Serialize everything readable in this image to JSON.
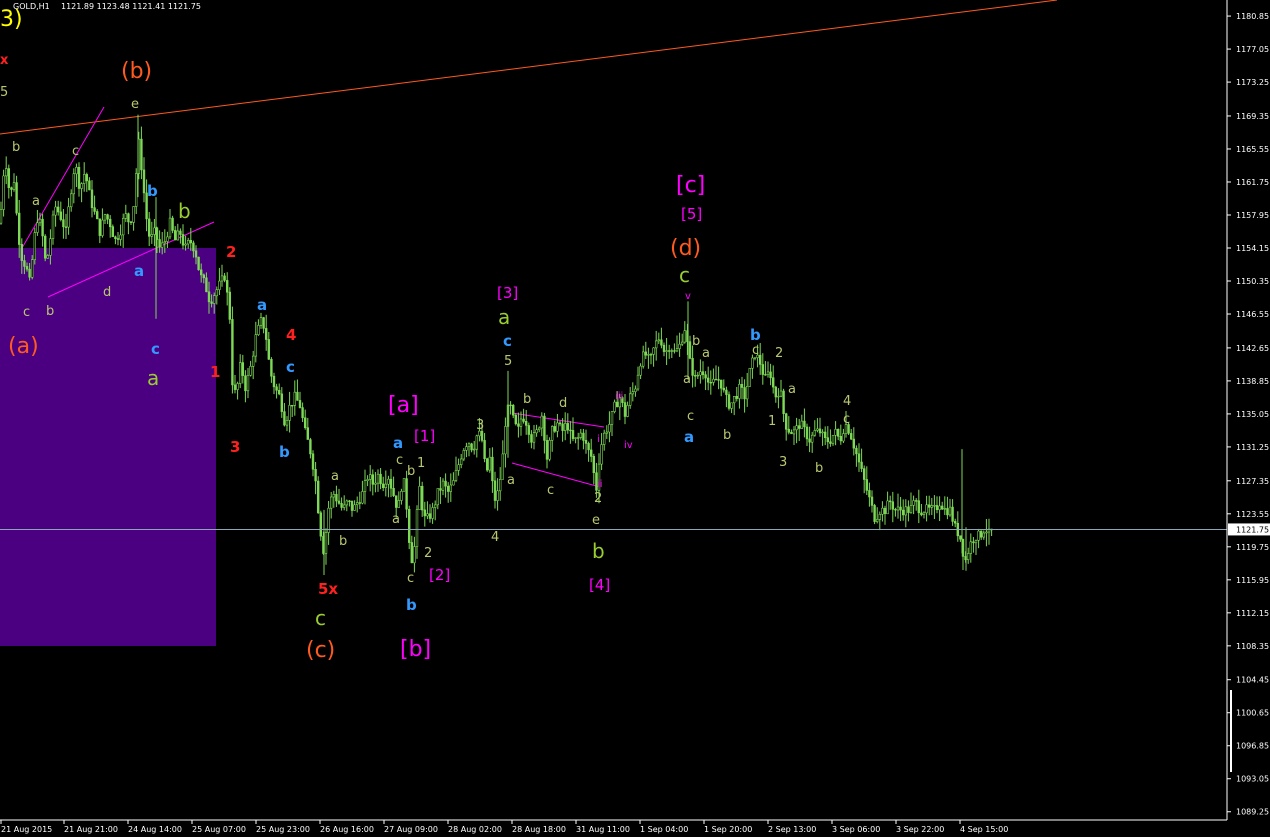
{
  "header": {
    "symbol": "GOLD,H1",
    "ohlc": "1121.89 1123.48 1121.41 1121.75",
    "corner_wave": "3)"
  },
  "price_axis": {
    "ticks": [
      "1180.85",
      "1177.05",
      "1173.25",
      "1169.35",
      "1165.55",
      "1161.75",
      "1157.95",
      "1154.15",
      "1150.35",
      "1146.55",
      "1142.65",
      "1138.85",
      "1135.05",
      "1131.25",
      "1127.35",
      "1123.55",
      "1119.75",
      "1115.95",
      "1112.15",
      "1108.35",
      "1104.45",
      "1100.65",
      "1096.85",
      "1093.05",
      "1089.25"
    ],
    "current_price": "1121.75"
  },
  "time_axis": {
    "ticks": [
      "21 Aug 2015",
      "21 Aug 21:00",
      "24 Aug 14:00",
      "25 Aug 07:00",
      "25 Aug 23:00",
      "26 Aug 16:00",
      "27 Aug 09:00",
      "28 Aug 02:00",
      "28 Aug 18:00",
      "31 Aug 11:00",
      "1 Sep 04:00",
      "1 Sep 20:00",
      "2 Sep 13:00",
      "3 Sep 06:00",
      "3 Sep 22:00",
      "4 Sep 15:00"
    ]
  },
  "colors": {
    "candle": "#7ed957",
    "box": "#4b0082",
    "trendline": "#ff5a1f",
    "channel": "#ff00ff",
    "price_line": "#8aa6b8"
  },
  "chart_data": {
    "type": "candlestick",
    "title": "GOLD,H1",
    "ylim": [
      1088.3,
      1182.7
    ],
    "x_start": "21 Aug 2015",
    "close_path": [
      [
        0,
        1157
      ],
      [
        5,
        1165
      ],
      [
        10,
        1160
      ],
      [
        14,
        1162
      ],
      [
        18,
        1156
      ],
      [
        22,
        1153
      ],
      [
        26,
        1152
      ],
      [
        30,
        1150
      ],
      [
        34,
        1155
      ],
      [
        38,
        1158
      ],
      [
        42,
        1156
      ],
      [
        46,
        1152
      ],
      [
        50,
        1155
      ],
      [
        55,
        1159
      ],
      [
        60,
        1158
      ],
      [
        66,
        1156
      ],
      [
        70,
        1160
      ],
      [
        75,
        1164
      ],
      [
        80,
        1161
      ],
      [
        85,
        1163
      ],
      [
        90,
        1160
      ],
      [
        95,
        1158
      ],
      [
        100,
        1156
      ],
      [
        105,
        1158
      ],
      [
        110,
        1157
      ],
      [
        115,
        1155
      ],
      [
        120,
        1156
      ],
      [
        125,
        1158
      ],
      [
        130,
        1157
      ],
      [
        135,
        1160
      ],
      [
        138,
        1167
      ],
      [
        142,
        1163
      ],
      [
        146,
        1158
      ],
      [
        150,
        1155
      ],
      [
        155,
        1156
      ],
      [
        160,
        1154
      ],
      [
        165,
        1155
      ],
      [
        170,
        1157
      ],
      [
        175,
        1155
      ],
      [
        180,
        1156
      ],
      [
        185,
        1154
      ],
      [
        190,
        1155
      ],
      [
        195,
        1154
      ],
      [
        200,
        1151
      ],
      [
        205,
        1150
      ],
      [
        210,
        1148
      ],
      [
        215,
        1149
      ],
      [
        220,
        1150
      ],
      [
        225,
        1151
      ],
      [
        230,
        1146
      ],
      [
        233,
        1137
      ],
      [
        237,
        1138
      ],
      [
        241,
        1141
      ],
      [
        245,
        1138
      ],
      [
        250,
        1140
      ],
      [
        256,
        1144
      ],
      [
        262,
        1146
      ],
      [
        266,
        1144
      ],
      [
        270,
        1140
      ],
      [
        275,
        1138
      ],
      [
        280,
        1137
      ],
      [
        285,
        1134
      ],
      [
        290,
        1136
      ],
      [
        295,
        1137
      ],
      [
        300,
        1136
      ],
      [
        305,
        1133
      ],
      [
        310,
        1131
      ],
      [
        315,
        1128
      ],
      [
        320,
        1122
      ],
      [
        324,
        1119
      ],
      [
        328,
        1124
      ],
      [
        333,
        1126
      ],
      [
        338,
        1125
      ],
      [
        343,
        1124
      ],
      [
        348,
        1125
      ],
      [
        353,
        1124
      ],
      [
        358,
        1125
      ],
      [
        363,
        1126
      ],
      [
        368,
        1128
      ],
      [
        373,
        1127
      ],
      [
        378,
        1128
      ],
      [
        383,
        1127
      ],
      [
        388,
        1128
      ],
      [
        393,
        1126
      ],
      [
        398,
        1124
      ],
      [
        403,
        1128
      ],
      [
        407,
        1124
      ],
      [
        411,
        1118
      ],
      [
        415,
        1120
      ],
      [
        419,
        1127
      ],
      [
        424,
        1123
      ],
      [
        428,
        1123
      ],
      [
        433,
        1124
      ],
      [
        438,
        1126
      ],
      [
        443,
        1127
      ],
      [
        448,
        1126
      ],
      [
        453,
        1127
      ],
      [
        458,
        1129
      ],
      [
        463,
        1131
      ],
      [
        468,
        1132
      ],
      [
        473,
        1131
      ],
      [
        478,
        1133
      ],
      [
        482,
        1132
      ],
      [
        486,
        1128
      ],
      [
        490,
        1130
      ],
      [
        494,
        1125
      ],
      [
        498,
        1126
      ],
      [
        502,
        1129
      ],
      [
        506,
        1135
      ],
      [
        510,
        1136
      ],
      [
        514,
        1134
      ],
      [
        518,
        1133
      ],
      [
        522,
        1135
      ],
      [
        527,
        1134
      ],
      [
        532,
        1132
      ],
      [
        537,
        1133
      ],
      [
        542,
        1135
      ],
      [
        547,
        1130
      ],
      [
        552,
        1133
      ],
      [
        557,
        1134
      ],
      [
        562,
        1133
      ],
      [
        567,
        1134
      ],
      [
        572,
        1132
      ],
      [
        577,
        1132
      ],
      [
        582,
        1133
      ],
      [
        587,
        1131
      ],
      [
        592,
        1130
      ],
      [
        596,
        1126
      ],
      [
        600,
        1131
      ],
      [
        605,
        1133
      ],
      [
        610,
        1134
      ],
      [
        615,
        1136
      ],
      [
        620,
        1137
      ],
      [
        625,
        1135
      ],
      [
        630,
        1137
      ],
      [
        635,
        1138
      ],
      [
        640,
        1141
      ],
      [
        645,
        1142
      ],
      [
        650,
        1141
      ],
      [
        655,
        1143
      ],
      [
        660,
        1144
      ],
      [
        665,
        1142
      ],
      [
        670,
        1143
      ],
      [
        675,
        1142
      ],
      [
        680,
        1143
      ],
      [
        685,
        1145
      ],
      [
        690,
        1141
      ],
      [
        695,
        1139
      ],
      [
        700,
        1140
      ],
      [
        705,
        1140
      ],
      [
        710,
        1138
      ],
      [
        715,
        1139
      ],
      [
        720,
        1139
      ],
      [
        725,
        1137
      ],
      [
        730,
        1136
      ],
      [
        735,
        1137
      ],
      [
        740,
        1138
      ],
      [
        745,
        1137
      ],
      [
        750,
        1140
      ],
      [
        755,
        1142
      ],
      [
        760,
        1141
      ],
      [
        765,
        1139
      ],
      [
        770,
        1140
      ],
      [
        775,
        1137
      ],
      [
        780,
        1138
      ],
      [
        785,
        1134
      ],
      [
        790,
        1133
      ],
      [
        795,
        1133
      ],
      [
        800,
        1134
      ],
      [
        805,
        1133
      ],
      [
        810,
        1132
      ],
      [
        815,
        1133
      ],
      [
        820,
        1133
      ],
      [
        825,
        1132
      ],
      [
        830,
        1132
      ],
      [
        835,
        1133
      ],
      [
        840,
        1132
      ],
      [
        845,
        1134
      ],
      [
        850,
        1133
      ],
      [
        855,
        1131
      ],
      [
        860,
        1129
      ],
      [
        865,
        1127
      ],
      [
        870,
        1125
      ],
      [
        875,
        1123
      ],
      [
        880,
        1124
      ],
      [
        885,
        1124
      ],
      [
        890,
        1125
      ],
      [
        895,
        1124
      ],
      [
        900,
        1124
      ],
      [
        905,
        1124
      ],
      [
        910,
        1124
      ],
      [
        915,
        1125
      ],
      [
        920,
        1124
      ],
      [
        925,
        1124
      ],
      [
        930,
        1124
      ],
      [
        935,
        1124
      ],
      [
        940,
        1125
      ],
      [
        945,
        1124
      ],
      [
        950,
        1124
      ],
      [
        955,
        1122
      ],
      [
        960,
        1121
      ],
      [
        965,
        1118
      ],
      [
        970,
        1120
      ],
      [
        975,
        1121
      ],
      [
        980,
        1121
      ],
      [
        985,
        1122
      ],
      [
        990,
        1121
      ],
      [
        993,
        1122
      ]
    ],
    "annotations": [
      {
        "text": "3)",
        "color": "#ffff00",
        "size": 22,
        "frame": "corner"
      },
      {
        "text": "x",
        "color": "#ff2020",
        "size": 13,
        "frame": "corner-x"
      },
      {
        "text": "(b)",
        "color": "#ff5a1f",
        "size": 22,
        "frame": "b1"
      },
      {
        "text": "e",
        "color": "#b8c870",
        "size": 13,
        "frame": "e1"
      },
      {
        "text": "5",
        "color": "#b8c870",
        "size": 13,
        "frame": "n5a"
      },
      {
        "text": "b",
        "color": "#b8c870",
        "size": 13,
        "frame": "b2"
      },
      {
        "text": "c",
        "color": "#b8c870",
        "size": 13,
        "frame": "c1"
      },
      {
        "text": "a",
        "color": "#b8c870",
        "size": 13,
        "frame": "a1"
      },
      {
        "text": "c",
        "color": "#b8c870",
        "size": 13,
        "frame": "c2"
      },
      {
        "text": "b",
        "color": "#b8c870",
        "size": 13,
        "frame": "b3"
      },
      {
        "text": "d",
        "color": "#b8c870",
        "size": 13,
        "frame": "d1"
      },
      {
        "text": "(a)",
        "color": "#ff5a1f",
        "size": 22,
        "frame": "a2"
      },
      {
        "text": "b",
        "color": "#3399ff",
        "size": 15,
        "frame": "b4"
      },
      {
        "text": "b",
        "color": "#9acd32",
        "size": 20,
        "frame": "b5"
      },
      {
        "text": "a",
        "color": "#3399ff",
        "size": 15,
        "frame": "a3"
      },
      {
        "text": "c",
        "color": "#3399ff",
        "size": 15,
        "frame": "c3"
      },
      {
        "text": "a",
        "color": "#9acd32",
        "size": 20,
        "frame": "a4"
      },
      {
        "text": "2",
        "color": "#ff2020",
        "size": 15,
        "frame": "r2"
      },
      {
        "text": "1",
        "color": "#ff2020",
        "size": 15,
        "frame": "r1"
      },
      {
        "text": "3",
        "color": "#ff2020",
        "size": 15,
        "frame": "r3"
      },
      {
        "text": "a",
        "color": "#3399ff",
        "size": 15,
        "frame": "a5"
      },
      {
        "text": "4",
        "color": "#ff2020",
        "size": 15,
        "frame": "r4"
      },
      {
        "text": "c",
        "color": "#3399ff",
        "size": 15,
        "frame": "c4"
      },
      {
        "text": "b",
        "color": "#3399ff",
        "size": 15,
        "frame": "b6"
      },
      {
        "text": "a",
        "color": "#b8c870",
        "size": 13,
        "frame": "a6"
      },
      {
        "text": "b",
        "color": "#b8c870",
        "size": 13,
        "frame": "b7"
      },
      {
        "text": "5x",
        "color": "#ff2020",
        "size": 15,
        "frame": "x5"
      },
      {
        "text": "c",
        "color": "#9acd32",
        "size": 20,
        "frame": "c5"
      },
      {
        "text": "(c)",
        "color": "#ff5a1f",
        "size": 22,
        "frame": "c6"
      },
      {
        "text": "[a]",
        "color": "#ff00ff",
        "size": 22,
        "frame": "ba1"
      },
      {
        "text": "a",
        "color": "#3399ff",
        "size": 15,
        "frame": "a7"
      },
      {
        "text": "[1]",
        "color": "#ff00ff",
        "size": 15,
        "frame": "bb1"
      },
      {
        "text": "c",
        "color": "#b8c870",
        "size": 13,
        "frame": "c7"
      },
      {
        "text": "1",
        "color": "#b8c870",
        "size": 13,
        "frame": "n1a"
      },
      {
        "text": "b",
        "color": "#b8c870",
        "size": 13,
        "frame": "b8"
      },
      {
        "text": "a",
        "color": "#b8c870",
        "size": 13,
        "frame": "a8"
      },
      {
        "text": "2",
        "color": "#b8c870",
        "size": 13,
        "frame": "n2a"
      },
      {
        "text": "c",
        "color": "#b8c870",
        "size": 13,
        "frame": "c8"
      },
      {
        "text": "[2]",
        "color": "#ff00ff",
        "size": 15,
        "frame": "bb2"
      },
      {
        "text": "b",
        "color": "#3399ff",
        "size": 15,
        "frame": "b9"
      },
      {
        "text": "[b]",
        "color": "#ff00ff",
        "size": 22,
        "frame": "bb3"
      },
      {
        "text": "3",
        "color": "#b8c870",
        "size": 13,
        "frame": "n3a"
      },
      {
        "text": "4",
        "color": "#b8c870",
        "size": 13,
        "frame": "n4a"
      },
      {
        "text": "[3]",
        "color": "#ff00ff",
        "size": 15,
        "frame": "bb4"
      },
      {
        "text": "a",
        "color": "#9acd32",
        "size": 20,
        "frame": "a9"
      },
      {
        "text": "c",
        "color": "#3399ff",
        "size": 15,
        "frame": "c9"
      },
      {
        "text": "5",
        "color": "#b8c870",
        "size": 13,
        "frame": "n5b"
      },
      {
        "text": "b",
        "color": "#b8c870",
        "size": 13,
        "frame": "b10"
      },
      {
        "text": "d",
        "color": "#b8c870",
        "size": 13,
        "frame": "d2"
      },
      {
        "text": "a",
        "color": "#b8c870",
        "size": 13,
        "frame": "a10"
      },
      {
        "text": "c",
        "color": "#b8c870",
        "size": 13,
        "frame": "c10"
      },
      {
        "text": "ii",
        "color": "#ff00ff",
        "size": 10,
        "frame": "ii"
      },
      {
        "text": "i",
        "color": "#ff00ff",
        "size": 10,
        "frame": "i"
      },
      {
        "text": "iii",
        "color": "#ff00ff",
        "size": 10,
        "frame": "iii"
      },
      {
        "text": "iv",
        "color": "#ff00ff",
        "size": 10,
        "frame": "iv"
      },
      {
        "text": "2",
        "color": "#b8c870",
        "size": 13,
        "frame": "n2b"
      },
      {
        "text": "e",
        "color": "#b8c870",
        "size": 13,
        "frame": "e2"
      },
      {
        "text": "b",
        "color": "#9acd32",
        "size": 20,
        "frame": "b11"
      },
      {
        "text": "[4]",
        "color": "#ff00ff",
        "size": 15,
        "frame": "bb5"
      },
      {
        "text": "[c]",
        "color": "#ff00ff",
        "size": 22,
        "frame": "bc1"
      },
      {
        "text": "[5]",
        "color": "#ff00ff",
        "size": 15,
        "frame": "bb6"
      },
      {
        "text": "(d)",
        "color": "#ff5a1f",
        "size": 22,
        "frame": "d3"
      },
      {
        "text": "c",
        "color": "#9acd32",
        "size": 20,
        "frame": "c11"
      },
      {
        "text": "v",
        "color": "#ff00ff",
        "size": 10,
        "frame": "v"
      },
      {
        "text": "b",
        "color": "#b8c870",
        "size": 13,
        "frame": "b12"
      },
      {
        "text": "a",
        "color": "#b8c870",
        "size": 13,
        "frame": "a11"
      },
      {
        "text": "a",
        "color": "#b8c870",
        "size": 13,
        "frame": "a12"
      },
      {
        "text": "c",
        "color": "#b8c870",
        "size": 13,
        "frame": "c12"
      },
      {
        "text": "a",
        "color": "#3399ff",
        "size": 15,
        "frame": "a13"
      },
      {
        "text": "b",
        "color": "#b8c870",
        "size": 13,
        "frame": "b13"
      },
      {
        "text": "b",
        "color": "#3399ff",
        "size": 15,
        "frame": "b14"
      },
      {
        "text": "c",
        "color": "#b8c870",
        "size": 13,
        "frame": "c13"
      },
      {
        "text": "2",
        "color": "#b8c870",
        "size": 13,
        "frame": "n2c"
      },
      {
        "text": "a",
        "color": "#b8c870",
        "size": 13,
        "frame": "a14"
      },
      {
        "text": "1",
        "color": "#b8c870",
        "size": 13,
        "frame": "n1b"
      },
      {
        "text": "3",
        "color": "#b8c870",
        "size": 13,
        "frame": "n3b"
      },
      {
        "text": "b",
        "color": "#b8c870",
        "size": 13,
        "frame": "b15"
      },
      {
        "text": "4",
        "color": "#b8c870",
        "size": 13,
        "frame": "n4b"
      },
      {
        "text": "c",
        "color": "#b8c870",
        "size": 13,
        "frame": "c14"
      }
    ]
  }
}
